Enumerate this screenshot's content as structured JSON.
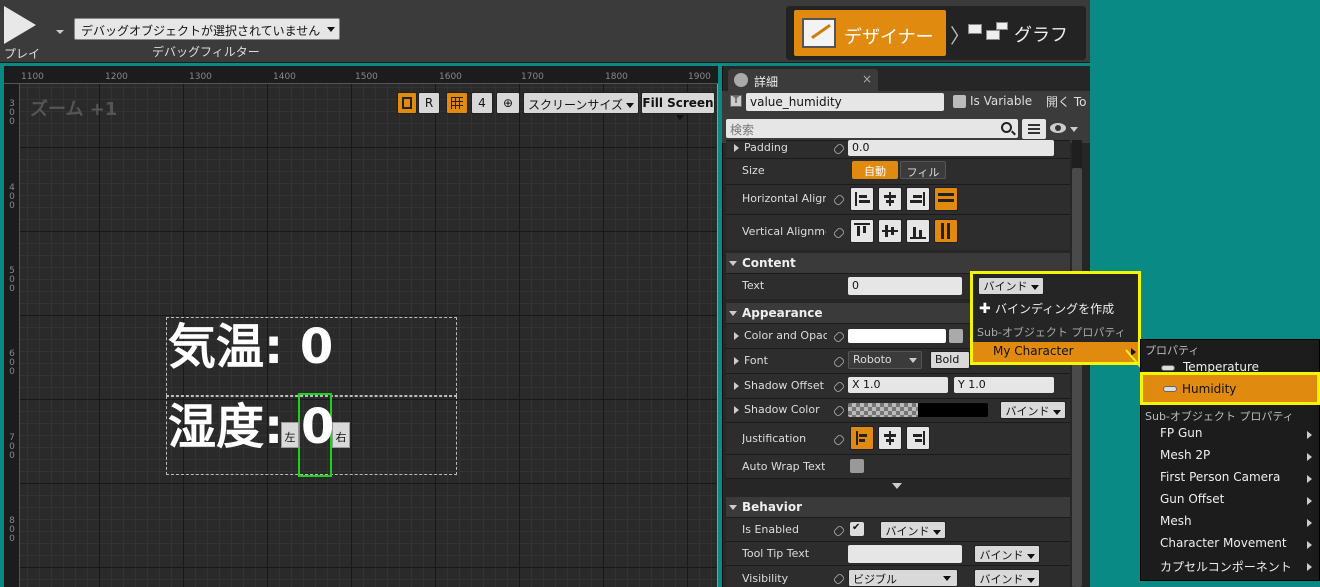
{
  "toolbar": {
    "play_label": "プレイ",
    "debug_select_value": "デバッグオブジェクトが選択されていません",
    "debug_filter_label": "デバッグフィルター",
    "designer_label": "デザイナー",
    "graph_label": "グラフ"
  },
  "canvas": {
    "zoom_label": "ズーム +1",
    "ruler_top": [
      "1100",
      "1200",
      "1300",
      "1400",
      "1500",
      "1600",
      "1700",
      "1800",
      "1900"
    ],
    "ruler_left": [
      "300",
      "400",
      "500",
      "600",
      "700",
      "800"
    ],
    "btn_r": "R",
    "btn_grid_size": "4",
    "screen_size_label": "スクリーンサイズ",
    "fill_screen_label": "Fill Screen",
    "text1": "気温: 0",
    "text2_prefix": "湿度:",
    "text2_value": "0",
    "handle_left": "左",
    "handle_right": "右"
  },
  "details": {
    "tab_label": "詳細",
    "tab_close": "×",
    "widget_name": "value_humidity",
    "is_variable_label": "Is Variable",
    "open_label": "開く To",
    "search_placeholder": "検索",
    "rows": {
      "padding_label": "Padding",
      "padding_value": "0.0",
      "size_label": "Size",
      "size_auto": "自動",
      "size_fill": "フィル",
      "halign_label": "Horizontal Alignment",
      "valign_label": "Vertical Alignment",
      "content_section": "Content",
      "text_label": "Text",
      "text_value": "0",
      "appearance_section": "Appearance",
      "color_label": "Color and Opacity",
      "font_label": "Font",
      "font_family": "Roboto",
      "font_style": "Bold",
      "shadow_offset_label": "Shadow Offset",
      "shadow_x": "X  1.0",
      "shadow_y": "Y  1.0",
      "shadow_color_label": "Shadow Color",
      "justification_label": "Justification",
      "auto_wrap_label": "Auto Wrap Text",
      "behavior_section": "Behavior",
      "is_enabled_label": "Is Enabled",
      "tooltip_label": "Tool Tip Text",
      "visibility_label": "Visibility",
      "visibility_value": "ビジブル",
      "bind_label": "バインド"
    }
  },
  "bind_menu": {
    "bind_label": "バインド",
    "create_binding": "バインディングを作成",
    "sub_object_props": "Sub-オブジェクト プロパティ",
    "my_character": "My Character"
  },
  "property_menu": {
    "properties_head": "プロパティ",
    "temperature": "Temperature",
    "humidity": "Humidity",
    "sub_object_props": "Sub-オブジェクト プロパティ",
    "components": [
      "FP Gun",
      "Mesh 2P",
      "First Person Camera",
      "Gun Offset",
      "Mesh",
      "Character Movement",
      "カプセルコンポーネント"
    ]
  },
  "colors": {
    "accent_orange": "#e08a10",
    "highlight_yellow": "#f5f500",
    "selection_green": "#1ad31a"
  }
}
